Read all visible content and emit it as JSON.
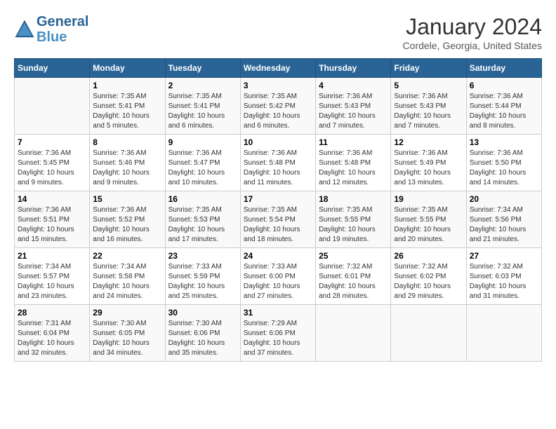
{
  "header": {
    "logo_line1": "General",
    "logo_line2": "Blue",
    "month": "January 2024",
    "location": "Cordele, Georgia, United States"
  },
  "days_of_week": [
    "Sunday",
    "Monday",
    "Tuesday",
    "Wednesday",
    "Thursday",
    "Friday",
    "Saturday"
  ],
  "weeks": [
    [
      {
        "day": "",
        "info": ""
      },
      {
        "day": "1",
        "info": "Sunrise: 7:35 AM\nSunset: 5:41 PM\nDaylight: 10 hours\nand 5 minutes."
      },
      {
        "day": "2",
        "info": "Sunrise: 7:35 AM\nSunset: 5:41 PM\nDaylight: 10 hours\nand 6 minutes."
      },
      {
        "day": "3",
        "info": "Sunrise: 7:35 AM\nSunset: 5:42 PM\nDaylight: 10 hours\nand 6 minutes."
      },
      {
        "day": "4",
        "info": "Sunrise: 7:36 AM\nSunset: 5:43 PM\nDaylight: 10 hours\nand 7 minutes."
      },
      {
        "day": "5",
        "info": "Sunrise: 7:36 AM\nSunset: 5:43 PM\nDaylight: 10 hours\nand 7 minutes."
      },
      {
        "day": "6",
        "info": "Sunrise: 7:36 AM\nSunset: 5:44 PM\nDaylight: 10 hours\nand 8 minutes."
      }
    ],
    [
      {
        "day": "7",
        "info": "Sunrise: 7:36 AM\nSunset: 5:45 PM\nDaylight: 10 hours\nand 9 minutes."
      },
      {
        "day": "8",
        "info": "Sunrise: 7:36 AM\nSunset: 5:46 PM\nDaylight: 10 hours\nand 9 minutes."
      },
      {
        "day": "9",
        "info": "Sunrise: 7:36 AM\nSunset: 5:47 PM\nDaylight: 10 hours\nand 10 minutes."
      },
      {
        "day": "10",
        "info": "Sunrise: 7:36 AM\nSunset: 5:48 PM\nDaylight: 10 hours\nand 11 minutes."
      },
      {
        "day": "11",
        "info": "Sunrise: 7:36 AM\nSunset: 5:48 PM\nDaylight: 10 hours\nand 12 minutes."
      },
      {
        "day": "12",
        "info": "Sunrise: 7:36 AM\nSunset: 5:49 PM\nDaylight: 10 hours\nand 13 minutes."
      },
      {
        "day": "13",
        "info": "Sunrise: 7:36 AM\nSunset: 5:50 PM\nDaylight: 10 hours\nand 14 minutes."
      }
    ],
    [
      {
        "day": "14",
        "info": "Sunrise: 7:36 AM\nSunset: 5:51 PM\nDaylight: 10 hours\nand 15 minutes."
      },
      {
        "day": "15",
        "info": "Sunrise: 7:36 AM\nSunset: 5:52 PM\nDaylight: 10 hours\nand 16 minutes."
      },
      {
        "day": "16",
        "info": "Sunrise: 7:35 AM\nSunset: 5:53 PM\nDaylight: 10 hours\nand 17 minutes."
      },
      {
        "day": "17",
        "info": "Sunrise: 7:35 AM\nSunset: 5:54 PM\nDaylight: 10 hours\nand 18 minutes."
      },
      {
        "day": "18",
        "info": "Sunrise: 7:35 AM\nSunset: 5:55 PM\nDaylight: 10 hours\nand 19 minutes."
      },
      {
        "day": "19",
        "info": "Sunrise: 7:35 AM\nSunset: 5:55 PM\nDaylight: 10 hours\nand 20 minutes."
      },
      {
        "day": "20",
        "info": "Sunrise: 7:34 AM\nSunset: 5:56 PM\nDaylight: 10 hours\nand 21 minutes."
      }
    ],
    [
      {
        "day": "21",
        "info": "Sunrise: 7:34 AM\nSunset: 5:57 PM\nDaylight: 10 hours\nand 23 minutes."
      },
      {
        "day": "22",
        "info": "Sunrise: 7:34 AM\nSunset: 5:58 PM\nDaylight: 10 hours\nand 24 minutes."
      },
      {
        "day": "23",
        "info": "Sunrise: 7:33 AM\nSunset: 5:59 PM\nDaylight: 10 hours\nand 25 minutes."
      },
      {
        "day": "24",
        "info": "Sunrise: 7:33 AM\nSunset: 6:00 PM\nDaylight: 10 hours\nand 27 minutes."
      },
      {
        "day": "25",
        "info": "Sunrise: 7:32 AM\nSunset: 6:01 PM\nDaylight: 10 hours\nand 28 minutes."
      },
      {
        "day": "26",
        "info": "Sunrise: 7:32 AM\nSunset: 6:02 PM\nDaylight: 10 hours\nand 29 minutes."
      },
      {
        "day": "27",
        "info": "Sunrise: 7:32 AM\nSunset: 6:03 PM\nDaylight: 10 hours\nand 31 minutes."
      }
    ],
    [
      {
        "day": "28",
        "info": "Sunrise: 7:31 AM\nSunset: 6:04 PM\nDaylight: 10 hours\nand 32 minutes."
      },
      {
        "day": "29",
        "info": "Sunrise: 7:30 AM\nSunset: 6:05 PM\nDaylight: 10 hours\nand 34 minutes."
      },
      {
        "day": "30",
        "info": "Sunrise: 7:30 AM\nSunset: 6:06 PM\nDaylight: 10 hours\nand 35 minutes."
      },
      {
        "day": "31",
        "info": "Sunrise: 7:29 AM\nSunset: 6:06 PM\nDaylight: 10 hours\nand 37 minutes."
      },
      {
        "day": "",
        "info": ""
      },
      {
        "day": "",
        "info": ""
      },
      {
        "day": "",
        "info": ""
      }
    ]
  ]
}
